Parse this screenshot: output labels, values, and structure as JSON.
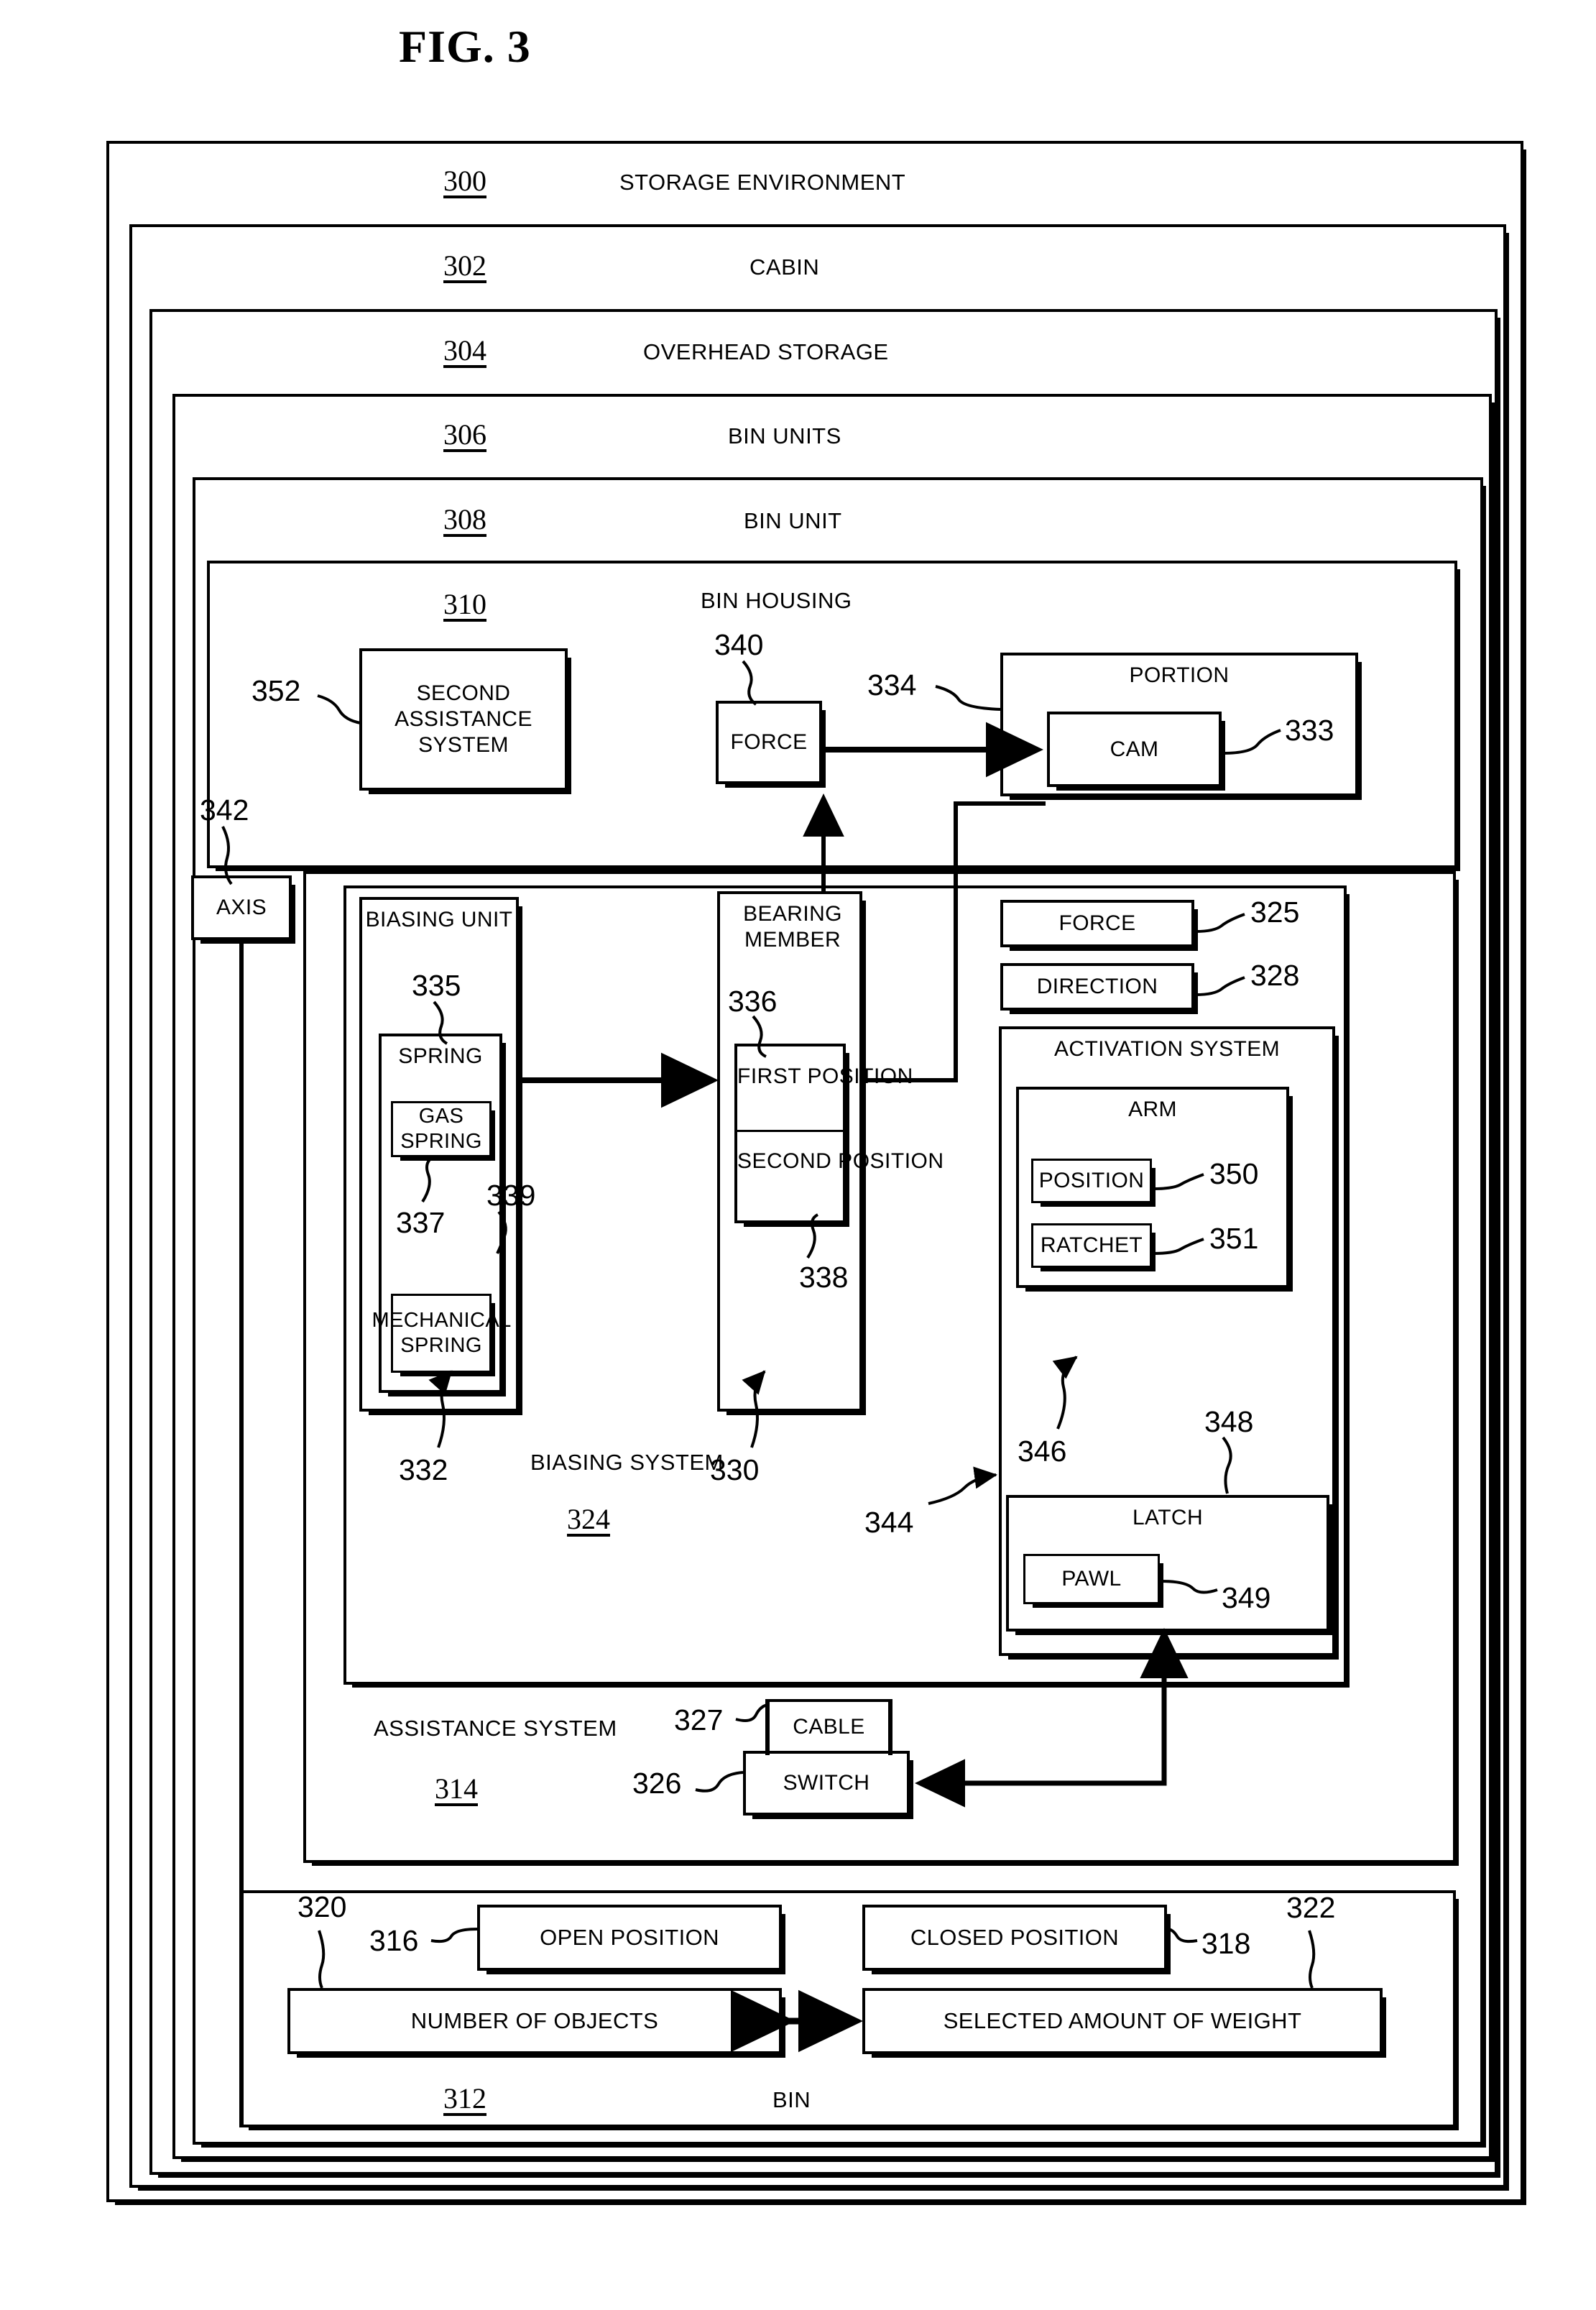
{
  "figure": {
    "title": "FIG. 3"
  },
  "frames": [
    {
      "num": "300",
      "label": "STORAGE ENVIRONMENT"
    },
    {
      "num": "302",
      "label": "CABIN"
    },
    {
      "num": "304",
      "label": "OVERHEAD STORAGE"
    },
    {
      "num": "306",
      "label": "BIN UNITS"
    },
    {
      "num": "308",
      "label": "BIN UNIT"
    },
    {
      "num": "310",
      "label": "BIN HOUSING"
    },
    {
      "num": "312",
      "label": "BIN"
    },
    {
      "num": "314",
      "label": "ASSISTANCE SYSTEM"
    },
    {
      "num": "324",
      "label": "BIASING SYSTEM"
    }
  ],
  "boxes": {
    "second_assistance_system": {
      "label": "SECOND ASSISTANCE SYSTEM",
      "ref": "352"
    },
    "force_housing": {
      "label": "FORCE",
      "ref": "340"
    },
    "portion": {
      "label": "PORTION",
      "ref": "334"
    },
    "cam": {
      "label": "CAM",
      "ref": "333"
    },
    "axis": {
      "label": "AXIS",
      "ref": "342"
    },
    "biasing_unit": {
      "label": "BIASING UNIT",
      "ref": "332"
    },
    "spring": {
      "label": "SPRING",
      "ref": "335"
    },
    "gas_spring": {
      "label": "GAS SPRING",
      "ref": "337"
    },
    "mechanical_spring": {
      "label": "MECHANICAL SPRING",
      "ref": "339"
    },
    "bearing_member": {
      "label": "BEARING MEMBER",
      "ref": "330"
    },
    "first_position": {
      "label": "FIRST POSITION",
      "ref": "336"
    },
    "second_position": {
      "label": "SECOND POSITION",
      "ref": "338"
    },
    "force_activation": {
      "label": "FORCE",
      "ref": "325"
    },
    "direction": {
      "label": "DIRECTION",
      "ref": "328"
    },
    "activation_system": {
      "label": "ACTIVATION SYSTEM",
      "ref": "344"
    },
    "arm": {
      "label": "ARM",
      "ref": "346"
    },
    "position": {
      "label": "POSITION",
      "ref": "350"
    },
    "ratchet": {
      "label": "RATCHET",
      "ref": "351"
    },
    "latch": {
      "label": "LATCH",
      "ref": "348"
    },
    "pawl": {
      "label": "PAWL",
      "ref": "349"
    },
    "cable": {
      "label": "CABLE",
      "ref": "327"
    },
    "switch": {
      "label": "SWITCH",
      "ref": "326"
    },
    "open_position": {
      "label": "OPEN POSITION",
      "ref": "316"
    },
    "closed_position": {
      "label": "CLOSED POSITION",
      "ref": "318"
    },
    "number_of_objects": {
      "label": "NUMBER OF OBJECTS",
      "ref": "320"
    },
    "selected_amount_of_weight": {
      "label": "SELECTED AMOUNT OF WEIGHT",
      "ref": "322"
    }
  },
  "reference_numerals": {
    "n300": "300",
    "n302": "302",
    "n304": "304",
    "n306": "306",
    "n308": "308",
    "n310": "310",
    "n312": "312",
    "n314": "314",
    "n316": "316",
    "n318": "318",
    "n320": "320",
    "n322": "322",
    "n324": "324",
    "n325": "325",
    "n326": "326",
    "n327": "327",
    "n328": "328",
    "n330": "330",
    "n332": "332",
    "n333": "333",
    "n334": "334",
    "n335": "335",
    "n336": "336",
    "n337": "337",
    "n338": "338",
    "n339": "339",
    "n340": "340",
    "n342": "342",
    "n344": "344",
    "n346": "346",
    "n348": "348",
    "n349": "349",
    "n350": "350",
    "n351": "351",
    "n352": "352"
  },
  "colors": {
    "ink": "#000000",
    "paper": "#ffffff"
  }
}
